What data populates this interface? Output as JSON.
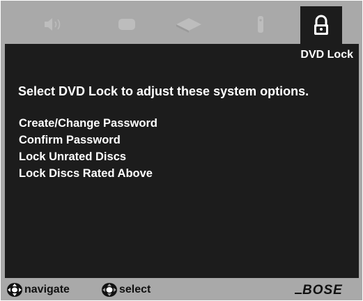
{
  "tabs": [
    {
      "name": "audio-tab",
      "icon": "speaker-icon",
      "active": false
    },
    {
      "name": "video-tab",
      "icon": "tv-screen-icon",
      "active": false
    },
    {
      "name": "disc-tab",
      "icon": "disc-tray-icon",
      "active": false
    },
    {
      "name": "remote-tab",
      "icon": "remote-control-icon",
      "active": false
    },
    {
      "name": "dvd-lock-tab",
      "icon": "padlock-icon",
      "active": true
    }
  ],
  "screen": {
    "section_title": "DVD Lock",
    "prompt": "Select DVD Lock to adjust these system options.",
    "options": [
      "Create/Change Password",
      "Confirm Password",
      "Lock Unrated Discs",
      "Lock Discs Rated Above"
    ]
  },
  "footer": {
    "navigate_label": "navigate",
    "select_label": "select",
    "brand_logo": "BOSE"
  },
  "colors": {
    "frame": "#a9a9a9",
    "screen": "#1c1c1c",
    "text": "#ffffff",
    "inactive_icon": "#bdbdbd"
  }
}
